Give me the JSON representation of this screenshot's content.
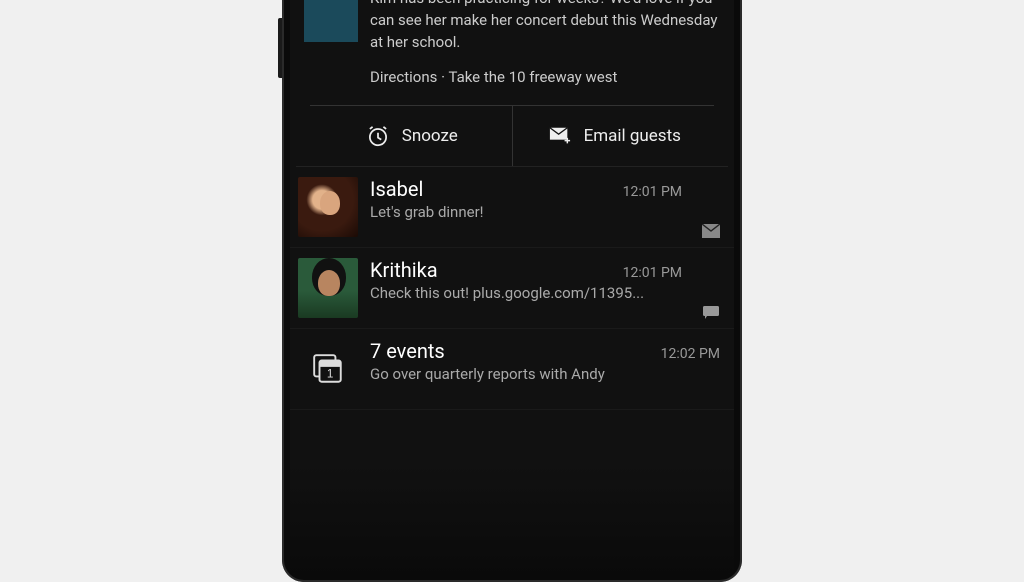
{
  "calendar": {
    "description": "Kim has been practicing for weeks? We'd love if you can see her make her concert debut this Wednesday at her school.",
    "directions": "Directions ·  Take the 10 freeway west",
    "snooze_label": "Snooze",
    "email_guests_label": "Email guests"
  },
  "notifications": [
    {
      "avatar_class": "isabel",
      "title": "Isabel",
      "time": "12:01 PM",
      "text": "Let's grab dinner!",
      "source": "gmail"
    },
    {
      "avatar_class": "krithika",
      "title": "Krithika",
      "time": "12:01 PM",
      "text": "Check this out! plus.google.com/11395...",
      "source": "talk"
    },
    {
      "icon": "calendar",
      "title": "7 events",
      "time": "12:02 PM",
      "text": "Go over quarterly reports with Andy",
      "source": "none"
    }
  ]
}
